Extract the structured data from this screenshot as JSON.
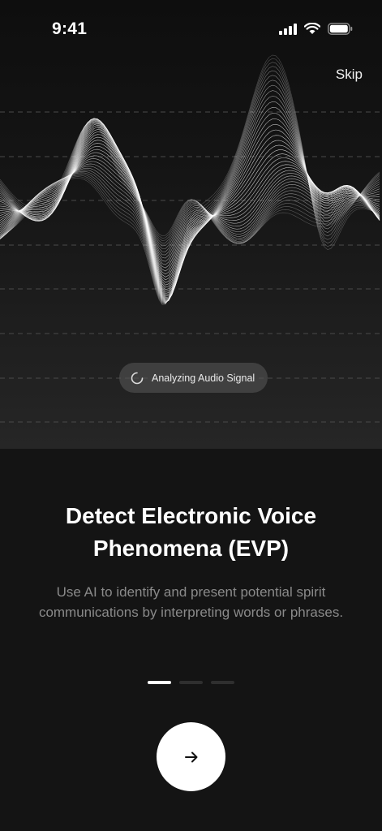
{
  "status_bar": {
    "time": "9:41"
  },
  "header": {
    "skip_label": "Skip"
  },
  "visual": {
    "status_pill": "Analyzing Audio Signal"
  },
  "content": {
    "title": "Detect Electronic Voice Phenomena (EVP)",
    "description": "Use AI to identify and present potential spirit communications by interpreting words or phrases."
  },
  "pagination": {
    "total": 3,
    "current": 1
  },
  "next_button": {
    "icon": "arrow-right-icon"
  },
  "colors": {
    "background": "#141414",
    "accent": "#ffffff",
    "muted_text": "#8a8a8a"
  }
}
